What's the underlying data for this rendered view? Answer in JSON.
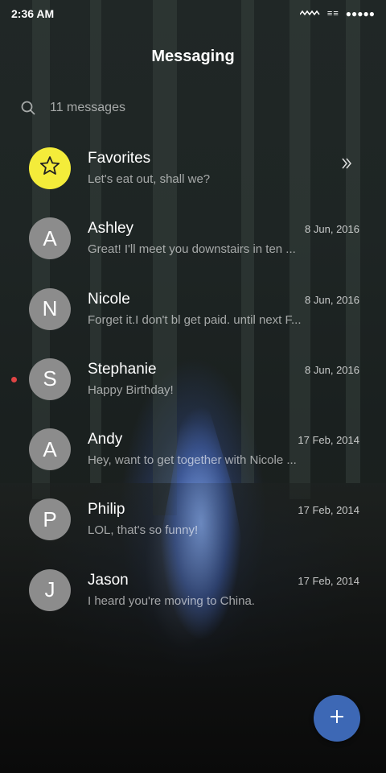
{
  "status_bar": {
    "time": "2:36 AM",
    "wifi_icon": "wifi-icon",
    "signal_text": "≡≡",
    "signal_dots": "●●●●●"
  },
  "header": {
    "title": "Messaging"
  },
  "search": {
    "icon": "search-icon",
    "text": "11 messages"
  },
  "favorites": {
    "name": "Favorites",
    "preview": "Let's eat out, shall we?",
    "icon": "star-icon",
    "chevron_icon": "double-chevron-right-icon",
    "avatar_color": "#f4ec3a"
  },
  "conversations": [
    {
      "initial": "A",
      "name": "Ashley",
      "preview": "Great! I'll meet you downstairs in ten ...",
      "date": "8 Jun, 2016",
      "unread": false
    },
    {
      "initial": "N",
      "name": "Nicole",
      "preview": "Forget it.I don't bl get paid. until next F...",
      "date": "8 Jun, 2016",
      "unread": false
    },
    {
      "initial": "S",
      "name": "Stephanie",
      "preview": "Happy Birthday!",
      "date": "8 Jun, 2016",
      "unread": true
    },
    {
      "initial": "A",
      "name": "Andy",
      "preview": "Hey, want to get together with Nicole ...",
      "date": "17 Feb, 2014",
      "unread": false
    },
    {
      "initial": "P",
      "name": "Philip",
      "preview": "LOL, that's so funny!",
      "date": "17 Feb, 2014",
      "unread": false
    },
    {
      "initial": "J",
      "name": "Jason",
      "preview": "I heard you're moving to China.",
      "date": "17 Feb, 2014",
      "unread": false
    }
  ],
  "fab": {
    "icon": "plus-icon",
    "color": "#3d68b5"
  },
  "colors": {
    "avatar_gray": "#8c8c8c",
    "unread_dot": "#e04444"
  }
}
